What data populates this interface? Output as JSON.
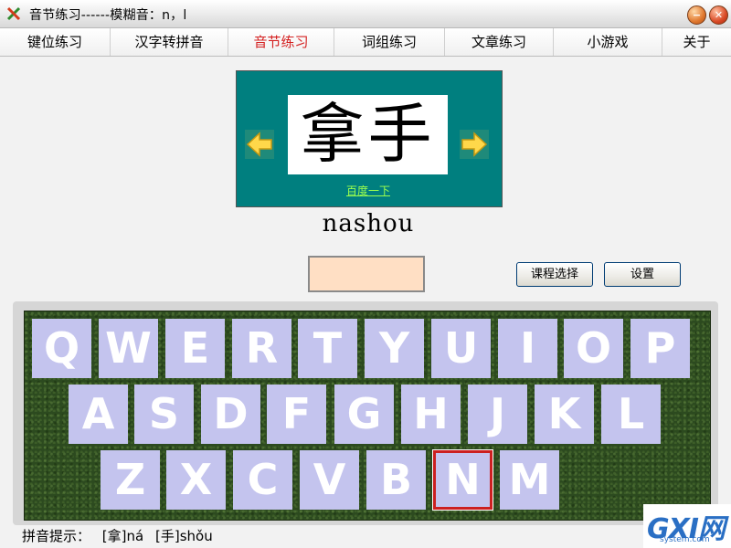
{
  "window": {
    "title": "音节练习------模糊音：n，l"
  },
  "menu": {
    "tabs": [
      {
        "label": "键位练习"
      },
      {
        "label": "汉字转拼音"
      },
      {
        "label": "音节练习"
      },
      {
        "label": "词组练习"
      },
      {
        "label": "文章练习"
      },
      {
        "label": "小游戏"
      },
      {
        "label": "关于"
      }
    ],
    "active_index": 2
  },
  "practice": {
    "characters": "拿手",
    "baidu_link": "百度一下",
    "pinyin": "nashou",
    "input_value": ""
  },
  "buttons": {
    "course_select": "课程选择",
    "settings": "设置"
  },
  "keyboard": {
    "rows": [
      [
        "Q",
        "W",
        "E",
        "R",
        "T",
        "Y",
        "U",
        "I",
        "O",
        "P"
      ],
      [
        "A",
        "S",
        "D",
        "F",
        "G",
        "H",
        "J",
        "K",
        "L"
      ],
      [
        "Z",
        "X",
        "C",
        "V",
        "B",
        "N",
        "M"
      ]
    ],
    "highlighted_key": "N"
  },
  "hint": {
    "label": "拼音提示：",
    "items": [
      "[拿]ná",
      "[手]shǒu"
    ]
  },
  "watermark": {
    "main": "GXI网",
    "sub": "system.com"
  },
  "colors": {
    "teal_panel": "#007f7f",
    "key_face": "#c4c4ee",
    "highlight_border": "#cc2020",
    "active_tab": "#d42020",
    "input_bg": "#ffdfc4"
  }
}
